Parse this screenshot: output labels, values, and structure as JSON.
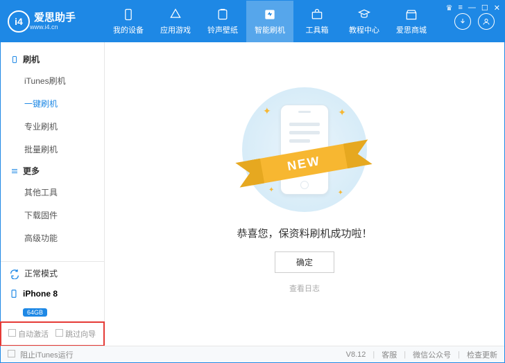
{
  "header": {
    "logo_text": "爱思助手",
    "logo_sub": "www.i4.cn",
    "nav": [
      {
        "label": "我的设备"
      },
      {
        "label": "应用游戏"
      },
      {
        "label": "铃声壁纸"
      },
      {
        "label": "智能刷机"
      },
      {
        "label": "工具箱"
      },
      {
        "label": "教程中心"
      },
      {
        "label": "爱思商城"
      }
    ]
  },
  "sidebar": {
    "group1": "刷机",
    "items1": [
      "iTunes刷机",
      "一键刷机",
      "专业刷机",
      "批量刷机"
    ],
    "group2": "更多",
    "items2": [
      "其他工具",
      "下载固件",
      "高级功能"
    ],
    "mode": "正常模式",
    "device_name": "iPhone 8",
    "storage": "64GB",
    "auto_activate": "自动激活",
    "skip_guide": "跳过向导"
  },
  "main": {
    "ribbon": "NEW",
    "success": "恭喜您，保资料刷机成功啦！",
    "ok": "确定",
    "view_log": "查看日志"
  },
  "footer": {
    "block_itunes": "阻止iTunes运行",
    "version": "V8.12",
    "support": "客服",
    "wechat": "微信公众号",
    "update": "检查更新"
  }
}
